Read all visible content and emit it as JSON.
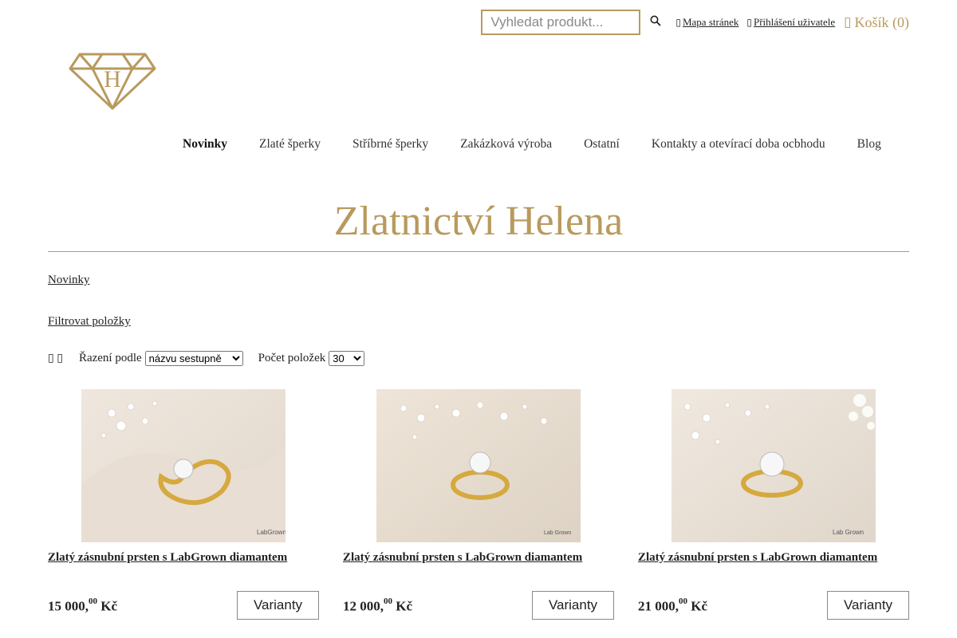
{
  "topbar": {
    "search_placeholder": "Vyhledat produkt...",
    "search_icon": "search-icon",
    "sitemap_label": "Mapa stránek",
    "login_label": "Přihlášení uživatele",
    "cart_label": "Košík (0)"
  },
  "nav": {
    "items": [
      "Novinky",
      "Zlaté šperky",
      "Stříbrné šperky",
      "Zakázková výroba",
      "Ostatní",
      "Kontakty a otevírací doba ocbhodu",
      "Blog"
    ],
    "active": "Novinky"
  },
  "page": {
    "title": "Zlatnictví Helena",
    "breadcrumb": "Novinky",
    "filter_link": "Filtrovat položky",
    "sort_label": "Řazení podle",
    "sort_value": "názvu sestupně",
    "count_label": "Počet položek",
    "count_value": "30"
  },
  "colors": {
    "accent": "#b89a5e"
  },
  "products": [
    {
      "name": "Zlatý zásnubní prsten s LabGrown diamantem",
      "price_main": "15 000,",
      "price_cents": "00",
      "currency": "Kč",
      "button": "Varianty",
      "img_caption": "LabGrown"
    },
    {
      "name": "Zlatý zásnubní prsten s LabGrown diamantem",
      "price_main": "12 000,",
      "price_cents": "00",
      "currency": "Kč",
      "button": "Varianty",
      "img_caption": "Lab Grown"
    },
    {
      "name": "Zlatý zásnubní prsten s LabGrown diamantem",
      "price_main": "21 000,",
      "price_cents": "00",
      "currency": "Kč",
      "button": "Varianty",
      "img_caption": "Lab Grown"
    }
  ]
}
